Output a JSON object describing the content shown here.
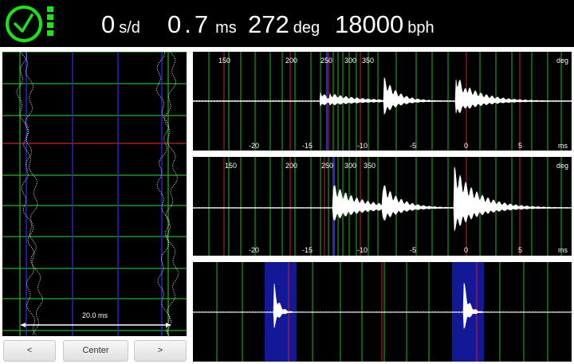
{
  "status": {
    "rate": {
      "value": "0",
      "unit": "s/d"
    },
    "beat_error": {
      "value": "0.7",
      "unit": "ms"
    },
    "amplitude": {
      "value": "272",
      "unit": "deg"
    },
    "beat_rate": {
      "value": "18000",
      "unit": "bph"
    },
    "icons": [
      "clock-icon",
      "signal-dots-icon"
    ]
  },
  "colors": {
    "background": "#000000",
    "grid_green": "#1fb81f",
    "marker_red": "#d42020",
    "marker_blue": "#2828d8",
    "highlight_blue": "#131996",
    "trace": "#ffffff"
  },
  "timegrapher": {
    "span_label": "20.0 ms"
  },
  "waveform_top": {
    "degree_ticks": [
      "150",
      "200",
      "250",
      "300",
      "350"
    ],
    "degree_unit": "deg",
    "ms_ticks": [
      "-20",
      "-15",
      "-10",
      "-5",
      "0",
      "5"
    ],
    "ms_unit": "ms"
  },
  "waveform_middle": {
    "degree_ticks": [
      "150",
      "200",
      "250",
      "300",
      "350"
    ],
    "degree_unit": "deg",
    "ms_ticks": [
      "-20",
      "-15",
      "-10",
      "-5",
      "0",
      "5"
    ],
    "ms_unit": "ms"
  },
  "controls": {
    "prev_label": "<",
    "center_label": "Center",
    "next_label": ">"
  }
}
